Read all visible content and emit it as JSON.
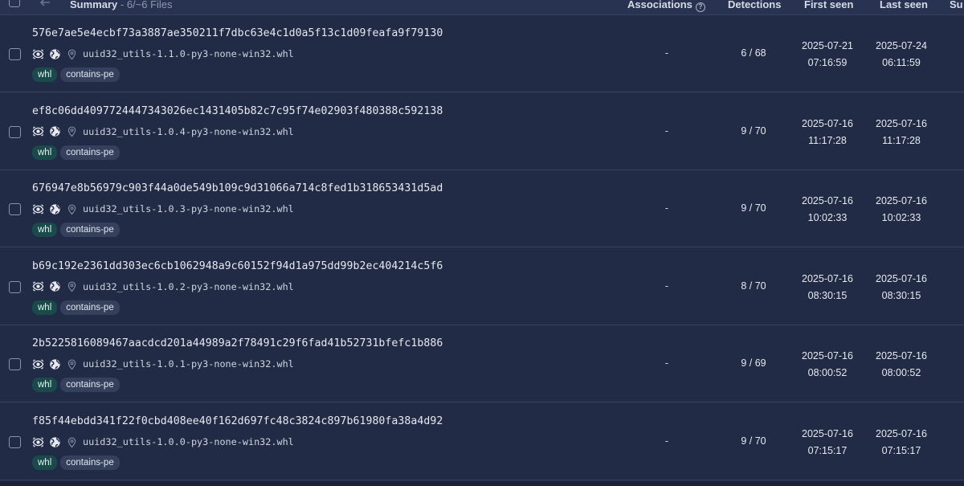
{
  "header": {
    "summary_label": "Summary",
    "summary_count": "- 6/~6 Files",
    "associations_label": "Associations",
    "detections_label": "Detections",
    "first_seen_label": "First seen",
    "last_seen_label": "Last seen",
    "submitters_label": "Su"
  },
  "colors": {
    "background": "#222b45",
    "tag_whl": "#1b4a4a",
    "tag_pe": "#34405c"
  },
  "rows": [
    {
      "hash": "576e7ae5e4ecbf73a3887ae350211f7dbc63e4c1d0a5f13c1d09feafa9f79130",
      "filename": "uuid32_utils-1.1.0-py3-none-win32.whl",
      "tags": [
        "whl",
        "contains-pe"
      ],
      "associations": "-",
      "detections": "6 / 68",
      "first_seen_date": "2025-07-21",
      "first_seen_time": "07:16:59",
      "last_seen_date": "2025-07-24",
      "last_seen_time": "06:11:59"
    },
    {
      "hash": "ef8c06dd4097724447343026ec1431405b82c7c95f74e02903f480388c592138",
      "filename": "uuid32_utils-1.0.4-py3-none-win32.whl",
      "tags": [
        "whl",
        "contains-pe"
      ],
      "associations": "-",
      "detections": "9 / 70",
      "first_seen_date": "2025-07-16",
      "first_seen_time": "11:17:28",
      "last_seen_date": "2025-07-16",
      "last_seen_time": "11:17:28"
    },
    {
      "hash": "676947e8b56979c903f44a0de549b109c9d31066a714c8fed1b318653431d5ad",
      "filename": "uuid32_utils-1.0.3-py3-none-win32.whl",
      "tags": [
        "whl",
        "contains-pe"
      ],
      "associations": "-",
      "detections": "9 / 70",
      "first_seen_date": "2025-07-16",
      "first_seen_time": "10:02:33",
      "last_seen_date": "2025-07-16",
      "last_seen_time": "10:02:33"
    },
    {
      "hash": "b69c192e2361dd303ec6cb1062948a9c60152f94d1a975dd99b2ec404214c5f6",
      "filename": "uuid32_utils-1.0.2-py3-none-win32.whl",
      "tags": [
        "whl",
        "contains-pe"
      ],
      "associations": "-",
      "detections": "8 / 70",
      "first_seen_date": "2025-07-16",
      "first_seen_time": "08:30:15",
      "last_seen_date": "2025-07-16",
      "last_seen_time": "08:30:15"
    },
    {
      "hash": "2b5225816089467aacdcd201a44989a2f78491c29f6fad41b52731bfefc1b886",
      "filename": "uuid32_utils-1.0.1-py3-none-win32.whl",
      "tags": [
        "whl",
        "contains-pe"
      ],
      "associations": "-",
      "detections": "9 / 69",
      "first_seen_date": "2025-07-16",
      "first_seen_time": "08:00:52",
      "last_seen_date": "2025-07-16",
      "last_seen_time": "08:00:52"
    },
    {
      "hash": "f85f44ebdd341f22f0cbd408ee40f162d697fc48c3824c897b61980fa38a4d92",
      "filename": "uuid32_utils-1.0.0-py3-none-win32.whl",
      "tags": [
        "whl",
        "contains-pe"
      ],
      "associations": "-",
      "detections": "9 / 70",
      "first_seen_date": "2025-07-16",
      "first_seen_time": "07:15:17",
      "last_seen_date": "2025-07-16",
      "last_seen_time": "07:15:17"
    }
  ]
}
